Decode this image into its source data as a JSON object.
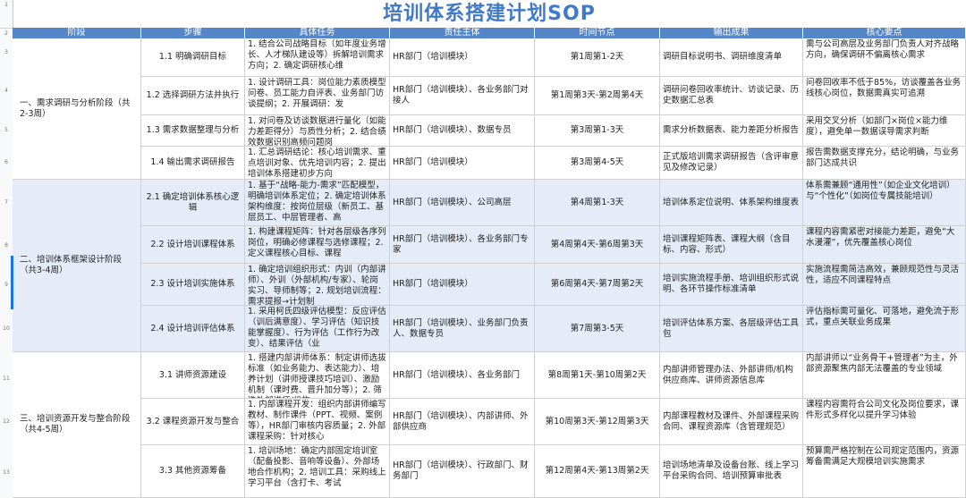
{
  "title": "培训体系搭建计划SOP",
  "row_numbers": [
    "1",
    "2",
    "3",
    "4",
    "5",
    "6",
    "7",
    "8",
    "9",
    "10",
    "11",
    "12",
    "13"
  ],
  "headers": [
    "阶段",
    "步骤",
    "具体任务",
    "责任主体",
    "时间节点",
    "输出成果",
    "核心要点"
  ],
  "phases": [
    {
      "label": "一、需求调研与分析阶段（共2-3周）"
    },
    {
      "label": "二、培训体系框架设计阶段（共3-4周）"
    },
    {
      "label": "三、培训资源开发与整合阶段（共4-5周）"
    }
  ],
  "rows": [
    {
      "step": "1.1 明确调研目标",
      "task": "1. 结合公司战略目标（如年度业务增长、人才梯队建设等）拆解培训需求方向；2. 确定调研核心维",
      "owner": "HR部门（培训模块）",
      "time": "第1周第1-2天",
      "output": "调研目标说明书、调研维度清单",
      "key": "需与公司高层及业务部门负责人对齐战略方向，确保调研不偏离核心需求"
    },
    {
      "step": "1.2 选择调研方法并执行",
      "task": "1. 设计调研工具：岗位能力素质模型问卷、员工能力自评表、业务部门访谈提纲；2. 开展调研：发",
      "owner": "HR部门（培训模块）、各业务部门对接人",
      "time": "第1周第3天-第2周第4天",
      "output": "调研问卷回收率统计、访谈记录、历史数据汇总表",
      "key": "问卷回收率不低于85%，访谈覆盖各业务线核心岗位，数据需真实可追溯"
    },
    {
      "step": "1.3 需求数据整理与分析",
      "task": "1. 对问卷及访谈数据进行量化（如能力差距得分）与质性分析；2. 结合绩效数据识别高频问题岗",
      "owner": "HR部门（培训模块）、数据专员",
      "time": "第3周第1-3天",
      "output": "需求分析数据表、能力差距分析报告",
      "key": "采用交叉分析（如部门×岗位×能力维度），避免单一数据误导需求判断"
    },
    {
      "step": "1.4 输出需求调研报告",
      "task": "1. 汇总调研结论：核心培训需求、重点培训对象、优先培训内容；2. 提出培训体系搭建初步方向",
      "owner": "HR部门（培训模块）",
      "time": "第3周第4-5天",
      "output": "正式版培训需求调研报告（含评审意见及修改记录）",
      "key": "报告需数据支撑充分，结论明确，与业务部门达成共识"
    },
    {
      "step": "2.1 确定培训体系核心逻辑",
      "task": "1. 基于“战略-能力-需求”匹配模型，明确培训体系定位；2. 确定培训体系架构维度：按岗位层级（新员工、基层员工、中层管理者、高",
      "owner": "HR部门（培训模块）、公司高层",
      "time": "第4周第1-3天",
      "output": "培训体系定位说明、体系架构维度表",
      "key": "体系需兼顾“通用性”（如企业文化培训）与“个性化”（如岗位专属技能培训）"
    },
    {
      "step": "2.2 设计培训课程体系",
      "task": "1. 构建课程矩阵：针对各层级各序列岗位，明确必修课程与选修课程；2. 定义课程核心目标、课程",
      "owner": "HR部门（培训模块）、各业务部门专家",
      "time": "第4周第4天-第6周第3天",
      "output": "培训课程矩阵表、课程大纲（含目标、内容、形式）",
      "key": "课程内容需紧密对接能力差距，避免“大水漫灌”，优先覆盖核心岗位"
    },
    {
      "step": "2.3 设计培训实施体系",
      "task": "1. 确定培训组织形式：内训（内部讲师）、外训（外部机构/专家）、轮岗实习、导师制等；2. 规划培训流程：需求提报→计划制",
      "owner": "HR部门（培训模块）",
      "time": "第6周第4天-第7周第2天",
      "output": "培训实施流程手册、培训组织形式说明、各环节操作标准清单",
      "key": "实施流程需简洁高效，兼顾规范性与灵活性，适应不同课程特点"
    },
    {
      "step": "2.4 设计培训评估体系",
      "task": "1. 采用柯氏四级评估模型：反应评估（训后满意度）、学习评估（知识技能掌握度）、行为评估（工作行为改变）、结果评估（业",
      "owner": "HR部门（培训模块）、业务部门负责人、数据专员",
      "time": "第7周第3-5天",
      "output": "培训评估体系方案、各层级评估工具包",
      "key": "评估指标需可量化、可落地，避免流于形式，重点关联业务成果"
    },
    {
      "step": "3.1 讲师资源建设",
      "task": "1. 搭建内部讲师体系：制定讲师选拔标准（如业务能力、表达能力）、培养计划（讲师授课技巧培训）、激励机制（课时费、晋升加分等）；2. 筛选外部讲师/机构",
      "owner": "HR部门（培训模块）、各业务部门",
      "time": "第8周第1天-第10周第2天",
      "output": "内部讲师管理办法、外部讲师/机构供应商库、讲师资源信息库",
      "key": "内部讲师以“业务骨干+管理者”为主，外部资源聚焦内部无法覆盖的专业领域"
    },
    {
      "step": "3.2 课程资源开发与整合",
      "task": "1. 内部课程开发：组织内部讲师编写教材、制作课件（PPT、视频、案例等），HR部门审核内容质量；2. 外部课程采购：针对核心",
      "owner": "HR部门（培训模块）、内部讲师、外部供应商",
      "time": "第10周第3天-第12周第3天",
      "output": "内部课程教材及课件、外部课程采购合同、课程资源库（含管理规范）",
      "key": "课程内容需符合公司文化及岗位要求，课件形式多样化以提升学习体验"
    },
    {
      "step": "3.3 其他资源筹备",
      "task": "1. 培训场地：确定内部固定培训室（配备投影、音响等设备）、外部场地合作机构；2. 培训工具：采购线上学习平台（含打卡、考试",
      "owner": "HR部门（培训模块）、行政部门、财务部门",
      "time": "第12周第4天-第13周第2天",
      "output": "培训场地清单及设备台账、线上学习平台采购合同、培训预算审批表",
      "key": "预算需严格控制在公司规定范围内，资源筹备需满足大规模培训实施需求"
    }
  ]
}
